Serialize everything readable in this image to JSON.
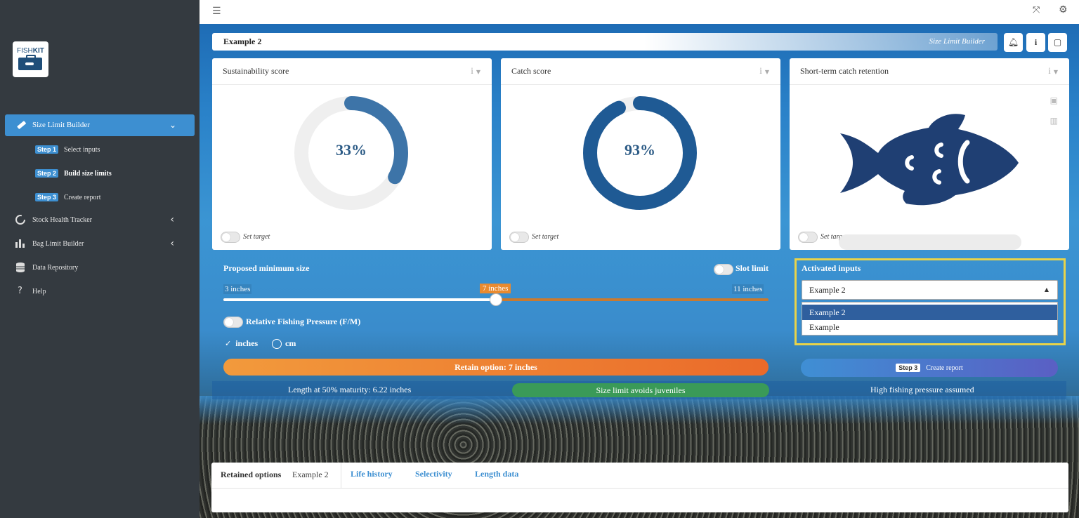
{
  "sidebar": {
    "logo_text_light": "FISH",
    "logo_text_bold": "KIT",
    "active_item": {
      "label": "Size Limit Builder",
      "icon": "ruler-icon"
    },
    "steps": [
      {
        "badge": "Step 1",
        "label": "Select inputs"
      },
      {
        "badge": "Step 2",
        "label": "Build size limits"
      },
      {
        "badge": "Step 3",
        "label": "Create report"
      }
    ],
    "items": [
      {
        "label": "Stock Health Tracker",
        "icon": "circle-notch-icon"
      },
      {
        "label": "Bag Limit Builder",
        "icon": "bar-chart-icon"
      },
      {
        "label": "Data Repository",
        "icon": "database-icon"
      },
      {
        "label": "Help",
        "icon": "question-icon"
      }
    ]
  },
  "header": {
    "title": "Example 2",
    "subtitle": "Size Limit Builder"
  },
  "cards": {
    "sustainability": {
      "title": "Sustainability score",
      "value": 33,
      "label": "33%",
      "target_label": "Set target"
    },
    "catch": {
      "title": "Catch score",
      "value": 93,
      "label": "93%",
      "target_label": "Set target"
    },
    "retention": {
      "title": "Short-term catch retention",
      "target_label": "Set target"
    }
  },
  "controls": {
    "proposed_title": "Proposed minimum size",
    "slot_limit_label": "Slot limit",
    "slider": {
      "min": 3,
      "max": 11,
      "value": 7,
      "min_label": "3 inches",
      "value_label": "7 inches",
      "max_label": "11 inches"
    },
    "rfp_label": "Relative Fishing Pressure (F/M)",
    "units": {
      "inches": "inches",
      "cm": "cm",
      "selected": "inches"
    },
    "retain_button": "Retain option: 7 inches",
    "activated_title": "Activated inputs",
    "activated_value": "Example 2",
    "activated_options": [
      "Example 2",
      "Example"
    ],
    "step3_badge": "Step 3",
    "step3_label": "Create report"
  },
  "info_strip": {
    "maturity": "Length at 50% maturity: 6.22 inches",
    "juveniles": "Size limit avoids juveniles",
    "pressure": "High fishing pressure assumed"
  },
  "tabs": {
    "retained_label": "Retained options",
    "retained_value": "Example 2",
    "items": [
      "Life history",
      "Selectivity",
      "Length data"
    ]
  },
  "colors": {
    "sidebar_bg": "#343a40",
    "accent": "#3d8fd1",
    "donut_33": "#3d74a8",
    "donut_93": "#1f5a94",
    "fish": "#1f3f73",
    "retain_btn": "#ee7e31",
    "highlight_border": "#e8d34a",
    "ok_green": "#3a9a58"
  }
}
